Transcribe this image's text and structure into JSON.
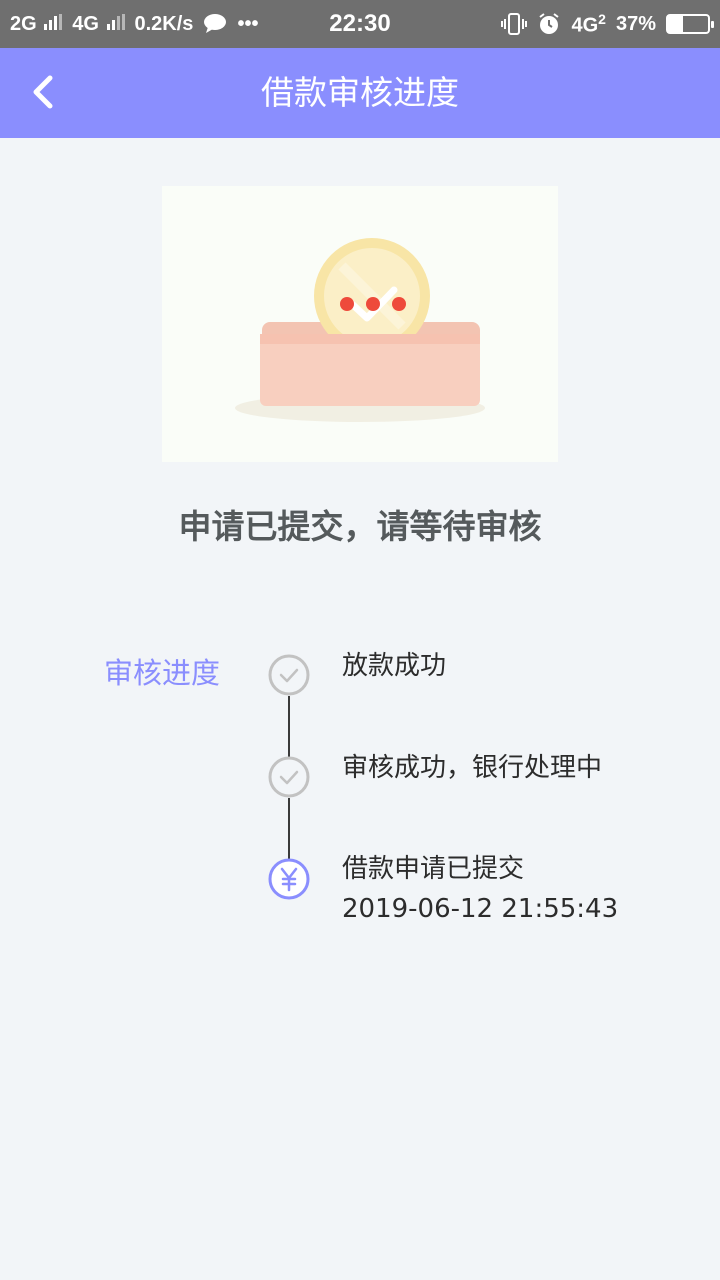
{
  "status_bar": {
    "sim1": "2G",
    "sim2": "4G",
    "speed": "0.2K/s",
    "more": "•••",
    "time": "22:30",
    "net": "4G",
    "net_sub": "2",
    "battery": "37%",
    "battery_level": 0.37
  },
  "header": {
    "title": "借款审核进度",
    "back_icon": "chevron-left-icon"
  },
  "main": {
    "status_message": "申请已提交，请等待审核",
    "progress_label": "审核进度"
  },
  "steps": [
    {
      "title": "放款成功",
      "time": "",
      "icon": "check-icon",
      "state": "pending"
    },
    {
      "title": "审核成功，银行处理中",
      "time": "",
      "icon": "check-icon",
      "state": "pending"
    },
    {
      "title": "借款申请已提交",
      "time": "2019-06-12 21:55:43",
      "icon": "yuan-icon",
      "state": "active"
    }
  ],
  "colors": {
    "accent": "#8a8efe",
    "header_bg": "#8a8efe",
    "background": "#f2f5f8",
    "pending_node": "#c2c2c2"
  }
}
